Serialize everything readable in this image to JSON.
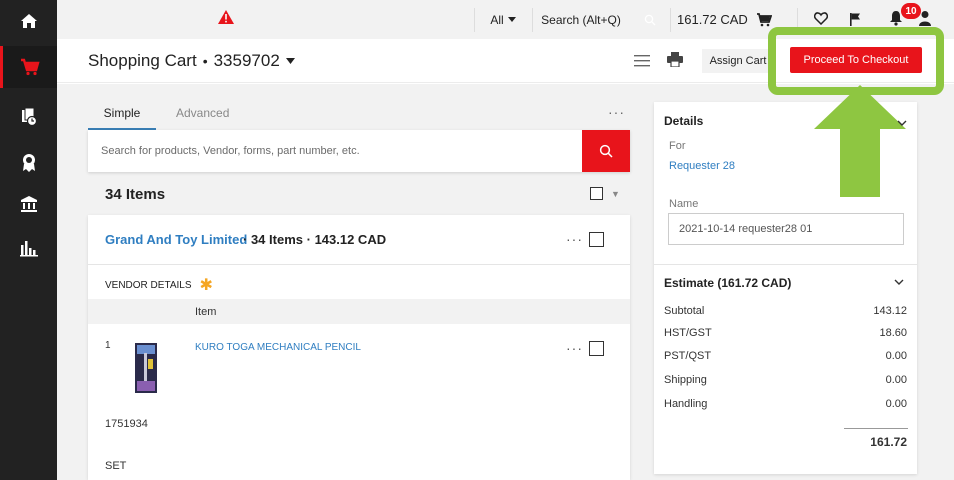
{
  "sidebar": {
    "items": [
      {
        "name": "home-icon",
        "active": false
      },
      {
        "name": "cart-icon",
        "active": true
      },
      {
        "name": "documents-clock-icon",
        "active": false
      },
      {
        "name": "badge-award-icon",
        "active": false
      },
      {
        "name": "bank-icon",
        "active": false
      },
      {
        "name": "analytics-chart-icon",
        "active": false
      }
    ]
  },
  "topbar": {
    "search_scope": "All",
    "search_placeholder": "Search (Alt+Q)",
    "cart_total": "161.72 CAD",
    "notification_count": "10"
  },
  "header": {
    "title": "Shopping Cart",
    "cart_number": "3359702",
    "assign_cart_label": "Assign Cart",
    "checkout_label": "Proceed To Checkout"
  },
  "search": {
    "tab_simple": "Simple",
    "tab_advanced": "Advanced",
    "placeholder": "Search for products, Vendor, forms, part number, etc."
  },
  "cart": {
    "items_count_label": "34 Items",
    "vendor": {
      "name": "Grand And Toy Limited",
      "items_label": "34 Items",
      "total": "143.12 CAD",
      "details_label": "VENDOR DETAILS"
    },
    "column_item": "Item",
    "lines": [
      {
        "num": "1",
        "name": "KURO TOGA MECHANICAL PENCIL",
        "part_number": "1751934",
        "uom": "SET"
      }
    ]
  },
  "details": {
    "title": "Details",
    "for_label": "For",
    "requester": "Requester 28",
    "name_label": "Name",
    "name_value": "2021-10-14 requester28 01"
  },
  "estimate": {
    "title": "Estimate (161.72 CAD)",
    "rows": [
      {
        "label": "Subtotal",
        "value": "143.12"
      },
      {
        "label": "HST/GST",
        "value": "18.60"
      },
      {
        "label": "PST/QST",
        "value": "0.00"
      },
      {
        "label": "Shipping",
        "value": "0.00"
      },
      {
        "label": "Handling",
        "value": "0.00"
      }
    ],
    "total": "161.72"
  },
  "colors": {
    "accent_red": "#e8141b",
    "link_blue": "#2f7ec1",
    "highlight_green": "#8ec641",
    "sidebar_bg": "#222222"
  }
}
